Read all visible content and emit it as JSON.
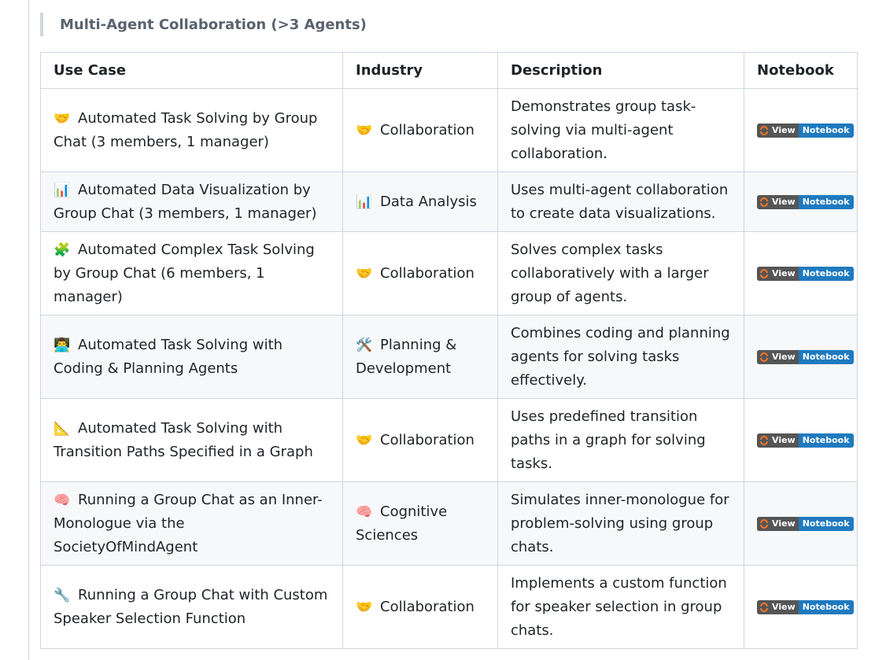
{
  "section": {
    "title": "Multi-Agent Collaboration (>3 Agents)"
  },
  "table": {
    "headers": [
      "Use Case",
      "Industry",
      "Description",
      "Notebook"
    ],
    "rows": [
      {
        "use_case_icon": "handshake-icon",
        "use_case_emoji": "🤝",
        "use_case": "Automated Task Solving by Group Chat (3 members, 1 manager)",
        "industry_icon": "handshake-icon",
        "industry_emoji": "🤝",
        "industry": "Collaboration",
        "description": "Demonstrates group task-solving via multi-agent collaboration.",
        "badge_left": "View",
        "badge_right": "Notebook"
      },
      {
        "use_case_icon": "bar-chart-icon",
        "use_case_emoji": "📊",
        "use_case": "Automated Data Visualization by Group Chat (3 members, 1 manager)",
        "industry_icon": "bar-chart-icon",
        "industry_emoji": "📊",
        "industry": "Data Analysis",
        "description": "Uses multi-agent collaboration to create data visualizations.",
        "badge_left": "View",
        "badge_right": "Notebook"
      },
      {
        "use_case_icon": "puzzle-piece-icon",
        "use_case_emoji": "🧩",
        "use_case": "Automated Complex Task Solving by Group Chat (6 members, 1 manager)",
        "industry_icon": "handshake-icon",
        "industry_emoji": "🤝",
        "industry": "Collaboration",
        "description": "Solves complex tasks collaboratively with a larger group of agents.",
        "badge_left": "View",
        "badge_right": "Notebook"
      },
      {
        "use_case_icon": "technologist-icon",
        "use_case_emoji": "👨‍💻",
        "use_case": "Automated Task Solving with Coding & Planning Agents",
        "industry_icon": "hammer-and-wrench-icon",
        "industry_emoji": "🛠️",
        "industry": "Planning & Development",
        "description": "Combines coding and planning agents for solving tasks effectively.",
        "badge_left": "View",
        "badge_right": "Notebook"
      },
      {
        "use_case_icon": "triangular-ruler-icon",
        "use_case_emoji": "📐",
        "use_case": "Automated Task Solving with Transition Paths Specified in a Graph",
        "industry_icon": "handshake-icon",
        "industry_emoji": "🤝",
        "industry": "Collaboration",
        "description": "Uses predefined transition paths in a graph for solving tasks.",
        "badge_left": "View",
        "badge_right": "Notebook"
      },
      {
        "use_case_icon": "brain-icon",
        "use_case_emoji": "🧠",
        "use_case": "Running a Group Chat as an Inner-Monologue via the SocietyOfMindAgent",
        "industry_icon": "brain-icon",
        "industry_emoji": "🧠",
        "industry": "Cognitive Sciences",
        "description": "Simulates inner-monologue for problem-solving using group chats.",
        "badge_left": "View",
        "badge_right": "Notebook"
      },
      {
        "use_case_icon": "wrench-icon",
        "use_case_emoji": "🔧",
        "use_case": "Running a Group Chat with Custom Speaker Selection Function",
        "industry_icon": "handshake-icon",
        "industry_emoji": "🤝",
        "industry": "Collaboration",
        "description": "Implements a custom function for speaker selection in group chats.",
        "badge_left": "View",
        "badge_right": "Notebook"
      }
    ]
  },
  "colors": {
    "border": "#d0d7de",
    "stripe": "#f6f8fa",
    "badge_left_bg": "#555555",
    "badge_right_bg": "#1f7abf",
    "jupyter_orange": "#f37726"
  }
}
